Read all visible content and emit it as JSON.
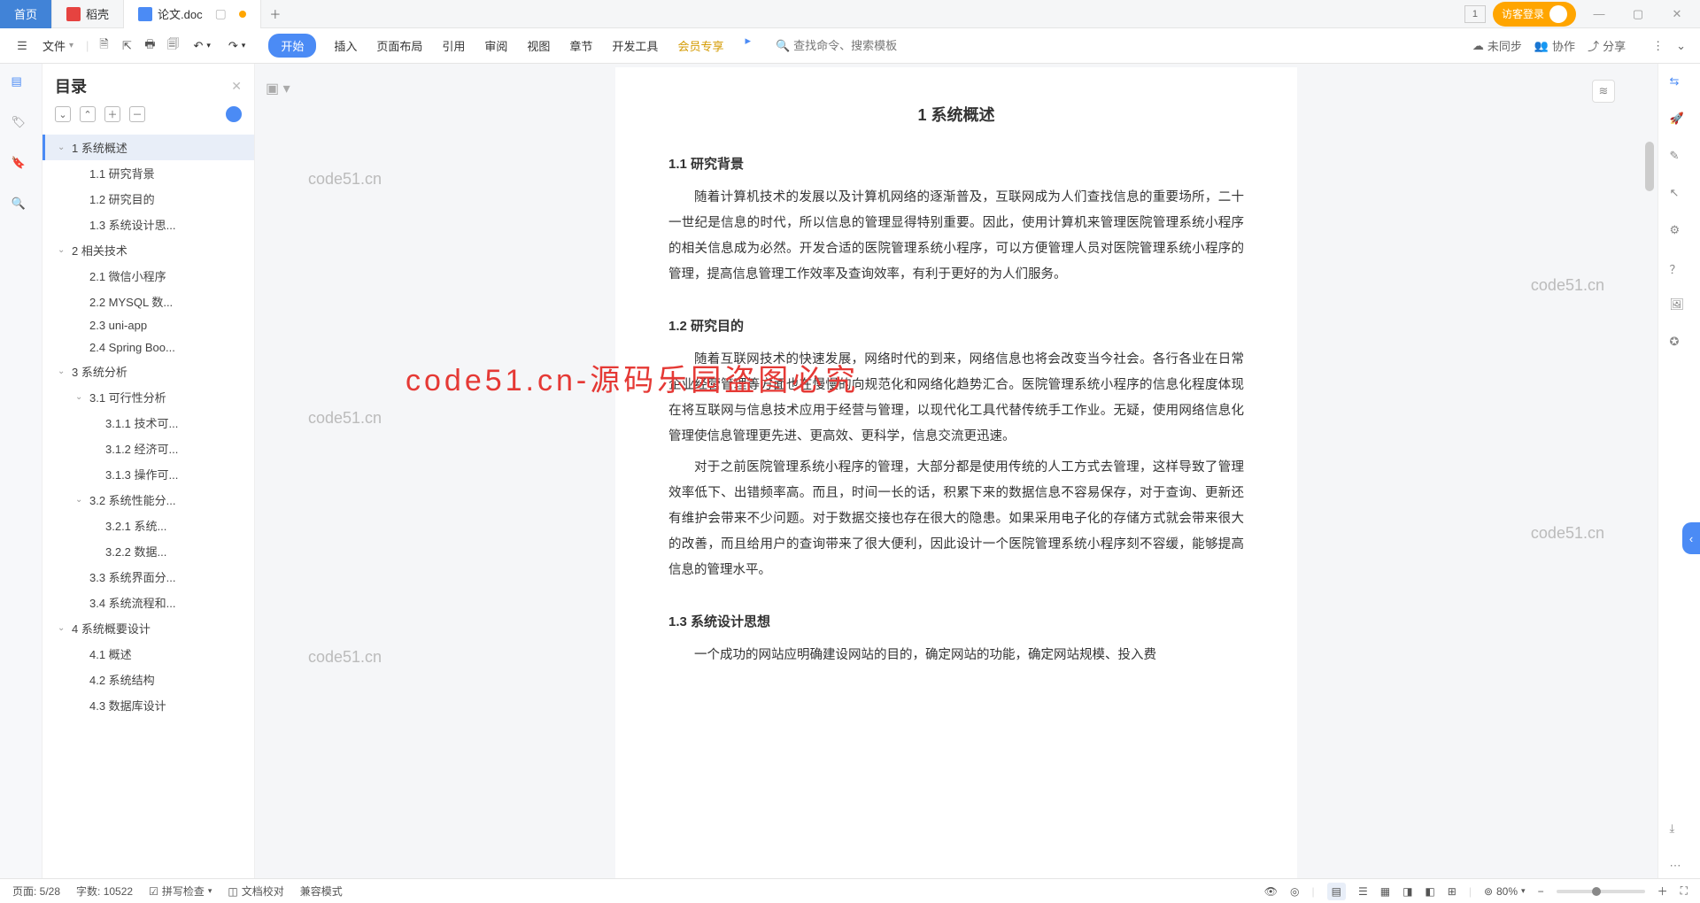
{
  "tabs": {
    "home": "首页",
    "daoke": "稻壳",
    "doc": "论文.doc"
  },
  "titlebar": {
    "numbox": "1",
    "guest": "访客登录"
  },
  "toolbar": {
    "file": "文件",
    "menu": [
      "开始",
      "插入",
      "页面布局",
      "引用",
      "审阅",
      "视图",
      "章节",
      "开发工具",
      "会员专享"
    ],
    "search_ph": "查找命令、搜索模板",
    "sync": "未同步",
    "coop": "协作",
    "share": "分享"
  },
  "outline": {
    "title": "目录",
    "ops_glyph": [
      "⌄",
      "⌃",
      "＋",
      "－"
    ],
    "items": [
      {
        "t": "1 系统概述",
        "lvl": 1,
        "ch": true,
        "sel": true
      },
      {
        "t": "1.1 研究背景",
        "lvl": 2
      },
      {
        "t": "1.2 研究目的",
        "lvl": 2
      },
      {
        "t": "1.3 系统设计思...",
        "lvl": 2
      },
      {
        "t": "2 相关技术",
        "lvl": 1,
        "ch": true
      },
      {
        "t": "2.1 微信小程序",
        "lvl": 2
      },
      {
        "t": "2.2 MYSQL 数...",
        "lvl": 2
      },
      {
        "t": "2.3 uni-app",
        "lvl": 2
      },
      {
        "t": "2.4 Spring Boo...",
        "lvl": 2
      },
      {
        "t": "3 系统分析",
        "lvl": 1,
        "ch": true
      },
      {
        "t": "3.1 可行性分析",
        "lvl": 2,
        "ch": true
      },
      {
        "t": "3.1.1 技术可...",
        "lvl": 3
      },
      {
        "t": "3.1.2 经济可...",
        "lvl": 3
      },
      {
        "t": "3.1.3 操作可...",
        "lvl": 3
      },
      {
        "t": "3.2 系统性能分...",
        "lvl": 2,
        "ch": true
      },
      {
        "t": "3.2.1 系统...",
        "lvl": 3
      },
      {
        "t": "3.2.2 数据...",
        "lvl": 3
      },
      {
        "t": "3.3 系统界面分...",
        "lvl": 2
      },
      {
        "t": "3.4 系统流程和...",
        "lvl": 2
      },
      {
        "t": "4 系统概要设计",
        "lvl": 1,
        "ch": true
      },
      {
        "t": "4.1 概述",
        "lvl": 2
      },
      {
        "t": "4.2 系统结构",
        "lvl": 2
      },
      {
        "t": "4.3 数据库设计",
        "lvl": 2
      }
    ]
  },
  "document": {
    "h1": "1 系统概述",
    "h2_1": "1.1 研究背景",
    "p1": "随着计算机技术的发展以及计算机网络的逐渐普及，互联网成为人们查找信息的重要场所，二十一世纪是信息的时代，所以信息的管理显得特别重要。因此，使用计算机来管理医院管理系统小程序的相关信息成为必然。开发合适的医院管理系统小程序，可以方便管理人员对医院管理系统小程序的管理，提高信息管理工作效率及查询效率，有利于更好的为人们服务。",
    "h2_2": "1.2 研究目的",
    "p2": "随着互联网技术的快速发展，网络时代的到来，网络信息也将会改变当今社会。各行各业在日常企业经营管理等方面也在慢慢的向规范化和网络化趋势汇合。医院管理系统小程序的信息化程度体现在将互联网与信息技术应用于经营与管理，以现代化工具代替传统手工作业。无疑，使用网络信息化管理使信息管理更先进、更高效、更科学，信息交流更迅速。",
    "p3": "对于之前医院管理系统小程序的管理，大部分都是使用传统的人工方式去管理，这样导致了管理效率低下、出错频率高。而且，时间一长的话，积累下来的数据信息不容易保存，对于查询、更新还有维护会带来不少问题。对于数据交接也存在很大的隐患。如果采用电子化的存储方式就会带来很大的改善，而且给用户的查询带来了很大便利，因此设计一个医院管理系统小程序刻不容缓，能够提高信息的管理水平。",
    "h2_3": "1.3 系统设计思想",
    "p4": "一个成功的网站应明确建设网站的目的，确定网站的功能，确定网站规模、投入费"
  },
  "statusbar": {
    "page": "页面: 5/28",
    "words": "字数: 10522",
    "spell": "拼写检查",
    "review": "文档校对",
    "compat": "兼容模式",
    "zoom": "80%"
  },
  "watermark": "code51.cn",
  "watermark_big": "code51.cn-源码乐园盗图必究"
}
